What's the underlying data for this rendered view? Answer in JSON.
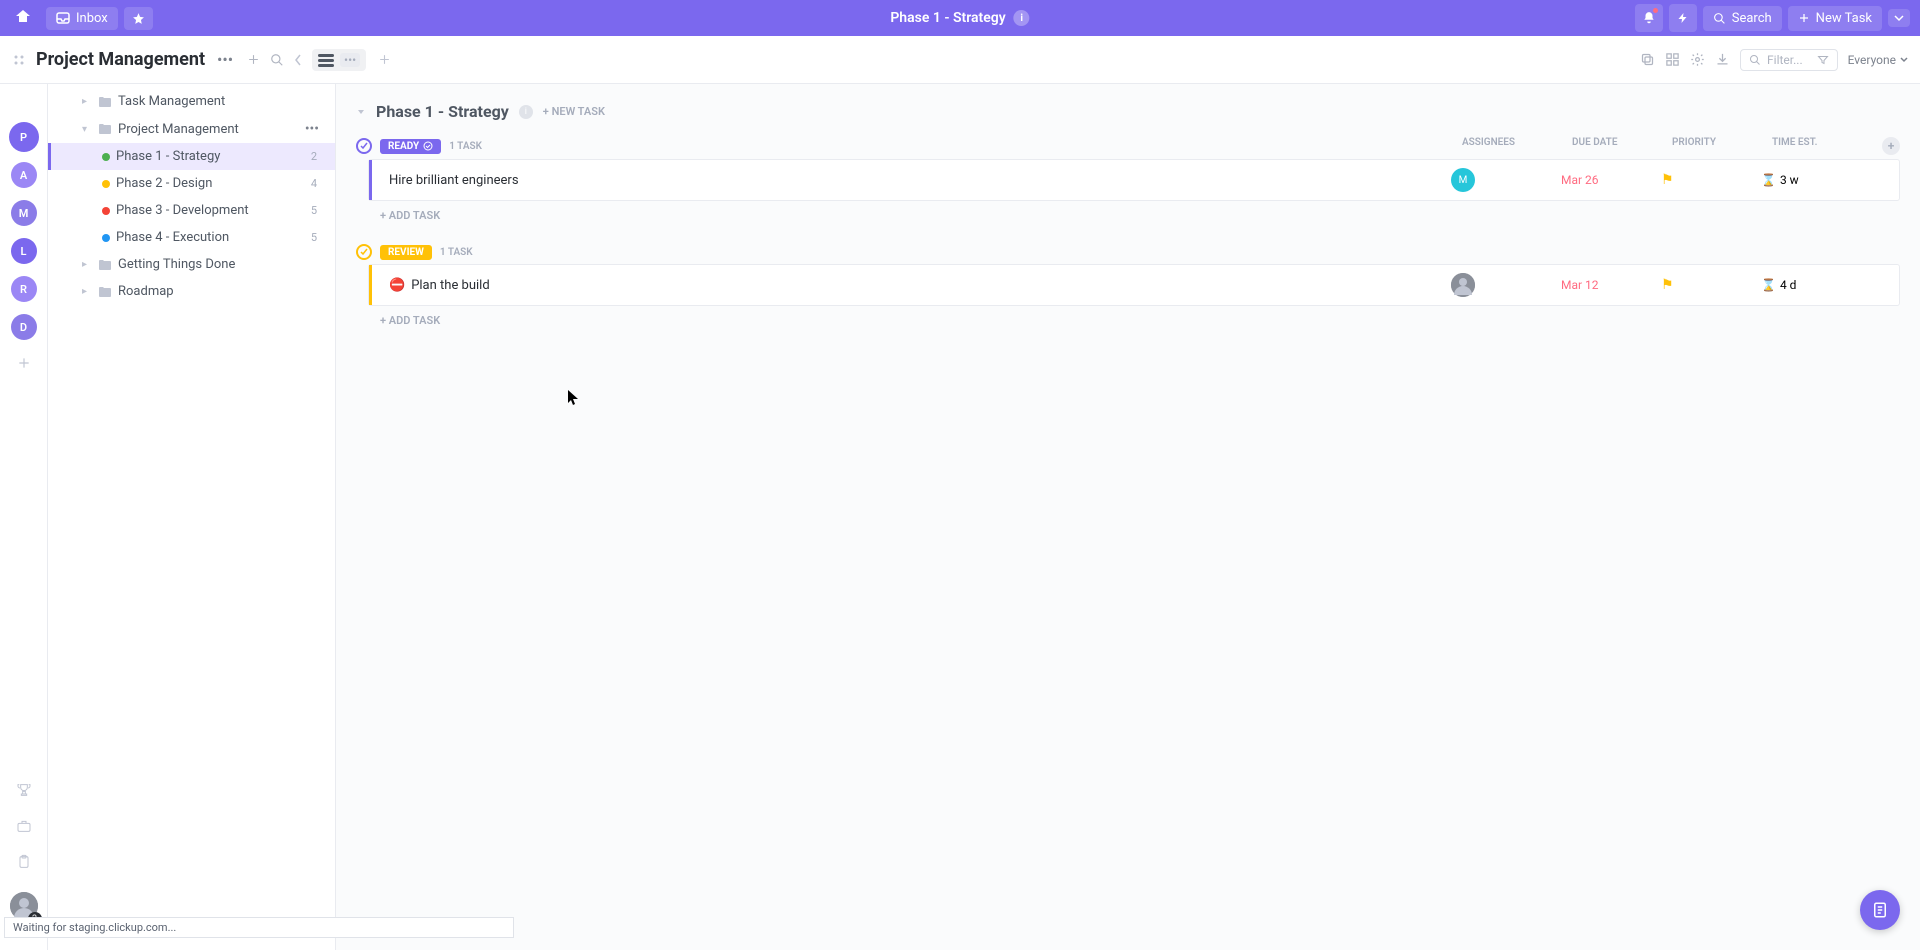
{
  "topbar": {
    "inbox_label": "Inbox",
    "page_title": "Phase 1 - Strategy",
    "search_label": "Search",
    "new_task_label": "New Task"
  },
  "subheader": {
    "space_title": "Project Management",
    "filter_placeholder": "Filter...",
    "everyone_label": "Everyone"
  },
  "rail_avatars": [
    {
      "letter": "P",
      "color": "#7b68ee",
      "selected": true
    },
    {
      "letter": "A",
      "color": "#9b87f5",
      "selected": false
    },
    {
      "letter": "M",
      "color": "#8b7ce8",
      "selected": false
    },
    {
      "letter": "L",
      "color": "#7b68ee",
      "selected": false
    },
    {
      "letter": "R",
      "color": "#9b87f5",
      "selected": false
    },
    {
      "letter": "D",
      "color": "#8b7ce8",
      "selected": false
    }
  ],
  "user_badge_count": "2",
  "sidebar": {
    "items": [
      {
        "type": "folder",
        "label": "Task Management",
        "indent": 1
      },
      {
        "type": "folder",
        "label": "Project Management",
        "indent": 1,
        "expanded": true,
        "showEllipsis": true
      },
      {
        "type": "phase",
        "label": "Phase 1 - Strategy",
        "dot": "#4caf50",
        "count": "2",
        "indent": 2,
        "selected": true
      },
      {
        "type": "phase",
        "label": "Phase 2 - Design",
        "dot": "#ffc107",
        "count": "4",
        "indent": 2
      },
      {
        "type": "phase",
        "label": "Phase 3 - Development",
        "dot": "#f44336",
        "count": "5",
        "indent": 2
      },
      {
        "type": "phase",
        "label": "Phase 4 - Execution",
        "dot": "#2196f3",
        "count": "5",
        "indent": 2
      },
      {
        "type": "folder",
        "label": "Getting Things Done",
        "indent": 1
      },
      {
        "type": "folder",
        "label": "Roadmap",
        "indent": 1
      }
    ]
  },
  "content": {
    "group_title": "Phase 1 - Strategy",
    "new_task_label": "+ NEW TASK",
    "columns": {
      "assignees": "ASSIGNEES",
      "due_date": "DUE DATE",
      "priority": "PRIORITY",
      "time_est": "TIME EST."
    },
    "sections": [
      {
        "status_name": "READY",
        "status_color": "#7b68ee",
        "task_count": "1 TASK",
        "tasks": [
          {
            "title": "Hire brilliant engineers",
            "assignee": {
              "type": "letter",
              "letter": "M",
              "color": "#26c6da"
            },
            "due": "Mar 26",
            "est": "3 w",
            "blocked": false
          }
        ]
      },
      {
        "status_name": "REVIEW",
        "status_color": "#ffc107",
        "task_count": "1 TASK",
        "tasks": [
          {
            "title": "Plan the build",
            "assignee": {
              "type": "photo"
            },
            "due": "Mar 12",
            "est": "4 d",
            "blocked": true
          }
        ]
      }
    ],
    "add_task_label": "+ ADD TASK"
  },
  "status_bar": "Waiting for staging.clickup.com..."
}
